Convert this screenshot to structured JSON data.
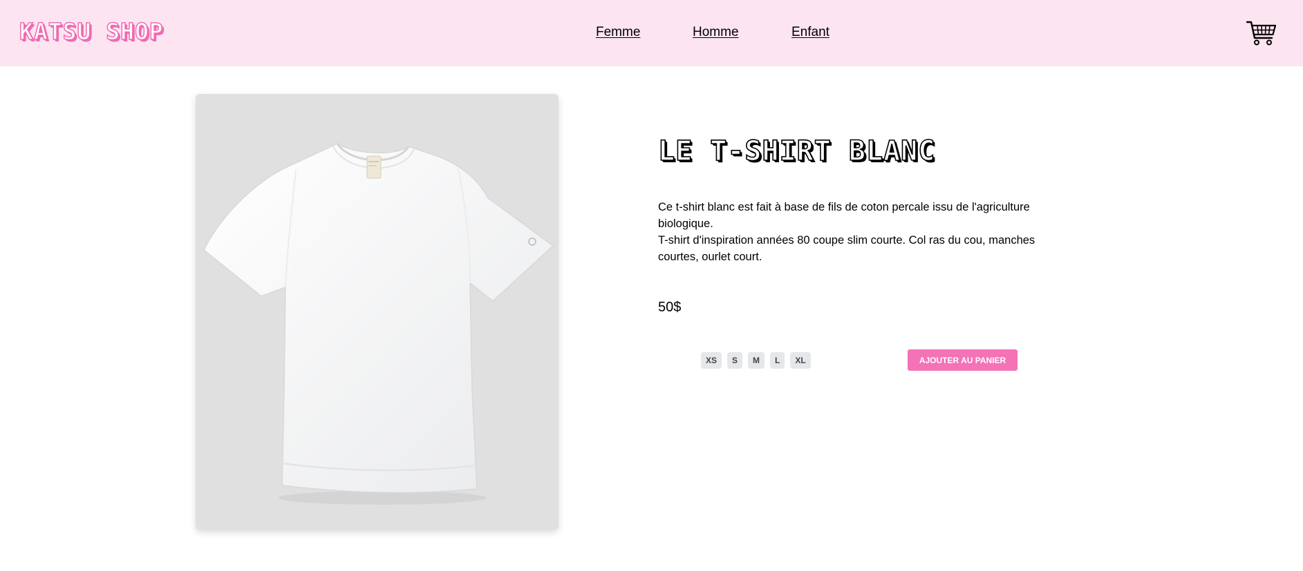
{
  "header": {
    "logo": "KATSU SHOP",
    "nav": [
      "Femme",
      "Homme",
      "Enfant"
    ],
    "cart_icon": "shopping-cart-icon",
    "background": "#fce4f1"
  },
  "product": {
    "title": "LE T-SHIRT BLANC",
    "description": [
      "Ce t-shirt blanc est fait à base de fils de coton percale issu de l'agriculture biologique.",
      "T-shirt d'inspiration années 80 coupe slim courte. Col ras du cou, manches courtes, ourlet court."
    ],
    "price": "50$",
    "sizes": [
      "XS",
      "S",
      "M",
      "L",
      "XL"
    ],
    "add_to_cart": "AJOUTER AU PANIER",
    "accent": "#f472b6"
  }
}
